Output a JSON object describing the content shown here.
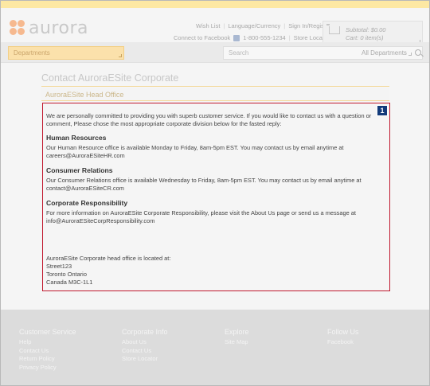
{
  "brand": {
    "logo_text": "aurora"
  },
  "utility_links": {
    "row1": [
      "Wish List",
      "Language/Currency",
      "Sign In/Register"
    ],
    "row2": {
      "facebook": "Connect to Facebook",
      "phone": "1-800-555-1234",
      "store_locator": "Store Locator"
    }
  },
  "cart": {
    "subtotal": "Subtotal: $0.00",
    "items": "Cart: 0 item(s)"
  },
  "nav": {
    "departments_label": "Departments",
    "search_placeholder": "Search",
    "search_department": "All Departments"
  },
  "page": {
    "title": "Contact AuroraESite Corporate",
    "section_tab": "AuroraESite Head Office",
    "badge": "1",
    "intro": "We are personally committed to providing you with superb customer service. If you would like to contact us with a question or comment, Please chose the most appropriate corporate division below for the fasted reply:",
    "sections": [
      {
        "heading": "Human Resources",
        "text": "Our Human Resource office is available Monday to Friday, 8am-5pm EST. You may contact us by email anytime at careers@AuroraESiteHR.com"
      },
      {
        "heading": "Consumer Relations",
        "text": "Our Consumer Relations office is available Wednesday to Friday, 8am-5pm EST. You may contact us by email anytime at contact@AuroraESiteCR.com"
      },
      {
        "heading": "Corporate Responsibility",
        "text": "For more information on AuroraESite Corporate Responsibility, please visit the About Us page or send us a message at info@AuroraESiteCorpResponsibility.com"
      }
    ],
    "address": {
      "lead": "AuroraESite Corporate head office is located at:",
      "line1": "Street123",
      "line2": "Toronto Ontario",
      "line3": "Canada M3C-1L1"
    }
  },
  "footer": {
    "columns": [
      {
        "heading": "Customer Service",
        "links": [
          "Help",
          "Contact Us",
          "Return Policy",
          "Privacy Policy"
        ]
      },
      {
        "heading": "Corporate Info",
        "links": [
          "About Us",
          "Contact Us",
          "Store Locator"
        ]
      },
      {
        "heading": "Explore",
        "links": [
          "Site Map"
        ]
      },
      {
        "heading": "Follow Us",
        "links": [
          "Facebook"
        ]
      }
    ]
  },
  "colors": {
    "accent": "#fde8a3",
    "highlight_border": "#c0182e",
    "badge": "#123a7a",
    "footer": "#dcdcdc"
  }
}
